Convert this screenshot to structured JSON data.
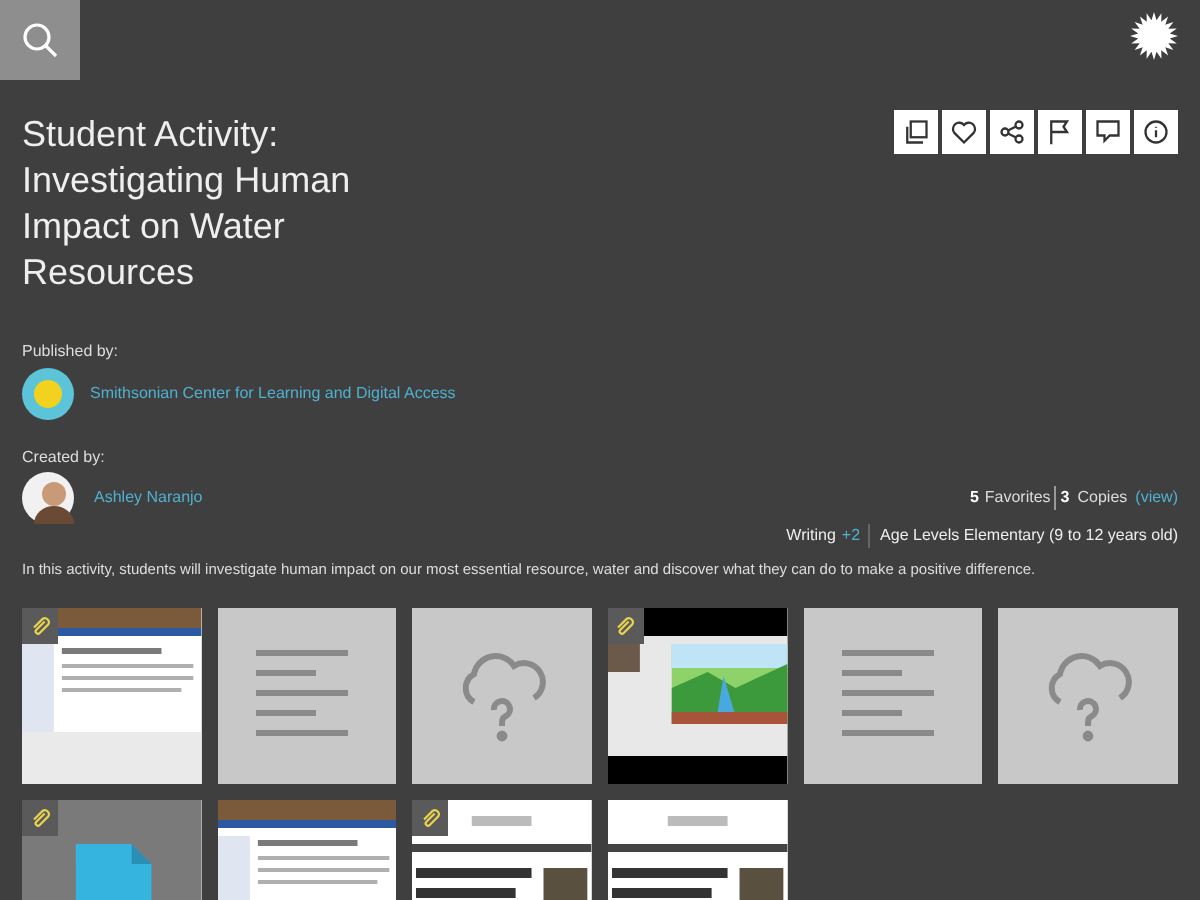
{
  "title": "Student Activity: Investigating Human Impact on Water Resources",
  "published_by": {
    "label": "Published by:",
    "name": "Smithsonian Center for Learning and Digital Access"
  },
  "created_by": {
    "label": "Created by:",
    "name": "Ashley Naranjo"
  },
  "stats": {
    "favorites_count": "5",
    "favorites_label": "Favorites",
    "copies_count": "3",
    "copies_label": "Copies",
    "view_link": "(view)"
  },
  "tags": {
    "subject": "Writing",
    "more": "+2",
    "age_levels": "Age Levels Elementary (9 to 12 years old)"
  },
  "description": "In this activity, students will investigate human impact on our most essential resource, water and discover what they can do to make a positive difference.",
  "tiles": [
    {
      "kind": "web-page",
      "attached": true
    },
    {
      "kind": "text",
      "attached": false
    },
    {
      "kind": "unknown",
      "attached": false
    },
    {
      "kind": "video",
      "attached": true
    },
    {
      "kind": "text",
      "attached": false
    },
    {
      "kind": "unknown",
      "attached": false
    },
    {
      "kind": "file",
      "attached": true
    },
    {
      "kind": "web-page",
      "attached": false
    },
    {
      "kind": "article",
      "attached": true
    },
    {
      "kind": "article",
      "attached": false
    }
  ]
}
